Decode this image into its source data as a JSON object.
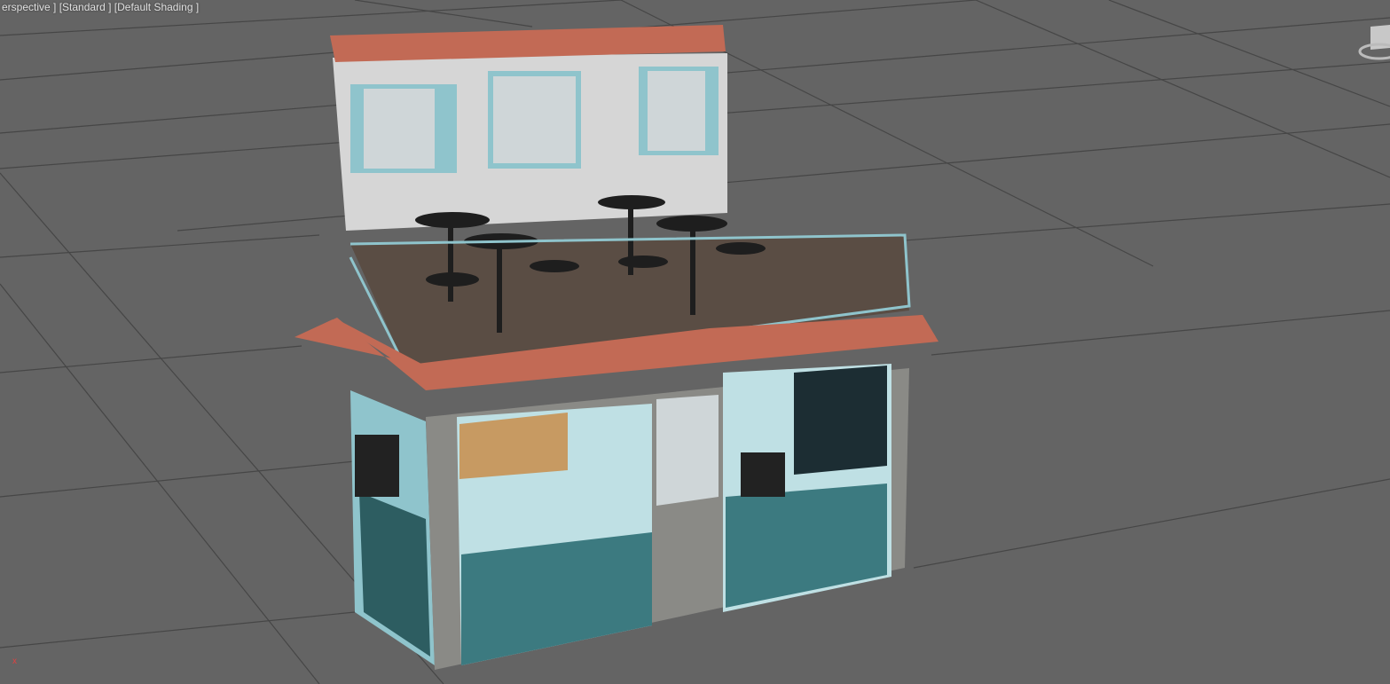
{
  "viewport": {
    "label_view": "erspective ]",
    "label_mode": "[Standard ]",
    "label_shading": "[Default Shading ]",
    "axis_label": "x",
    "colors": {
      "background": "#646464",
      "grid": "#3e3e3e",
      "roof": "#c26a55",
      "trim": "#8fc4cc",
      "wall": "#dadada",
      "stone": "#8a8a86",
      "panel": "#3c7a80"
    }
  }
}
